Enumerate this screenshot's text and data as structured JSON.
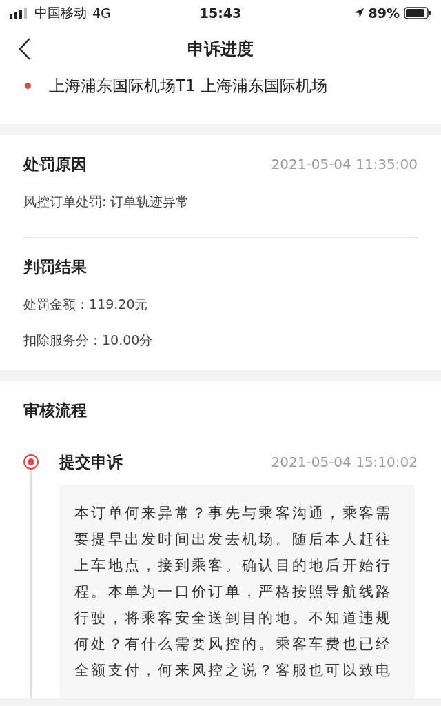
{
  "status_bar": {
    "carrier": "中国移动",
    "network": "4G",
    "time": "15:43",
    "battery": "89%"
  },
  "nav": {
    "title": "申诉进度"
  },
  "location": {
    "text": "上海浦东国际机场T1 上海浦东国际机场"
  },
  "penalty": {
    "reason_title": "处罚原因",
    "reason_time": "2021-05-04 11:35:00",
    "reason": "风控订单处罚: 订单轨迹异常",
    "result_title": "判罚结果",
    "results": [
      "处罚金额：119.20元",
      "扣除服务分：10.00分"
    ]
  },
  "review": {
    "title": "审核流程",
    "steps": [
      {
        "title": "提交申诉",
        "time": "2021-05-04 15:10:02",
        "selected": true,
        "content": "本订单何来异常？事先与乘客沟通，乘客需要提早出发时间出发去机场。随后本人赶往上车地点，接到乘客。确认目的地后开始行程。本单为一口价订单，严格按照导航线路行驶，将乘客安全送到目的地。不知道违规何处？有什么需要风控的。乘客车费也已经全额支付，何来风控之说？客服也可以致电"
      }
    ]
  }
}
